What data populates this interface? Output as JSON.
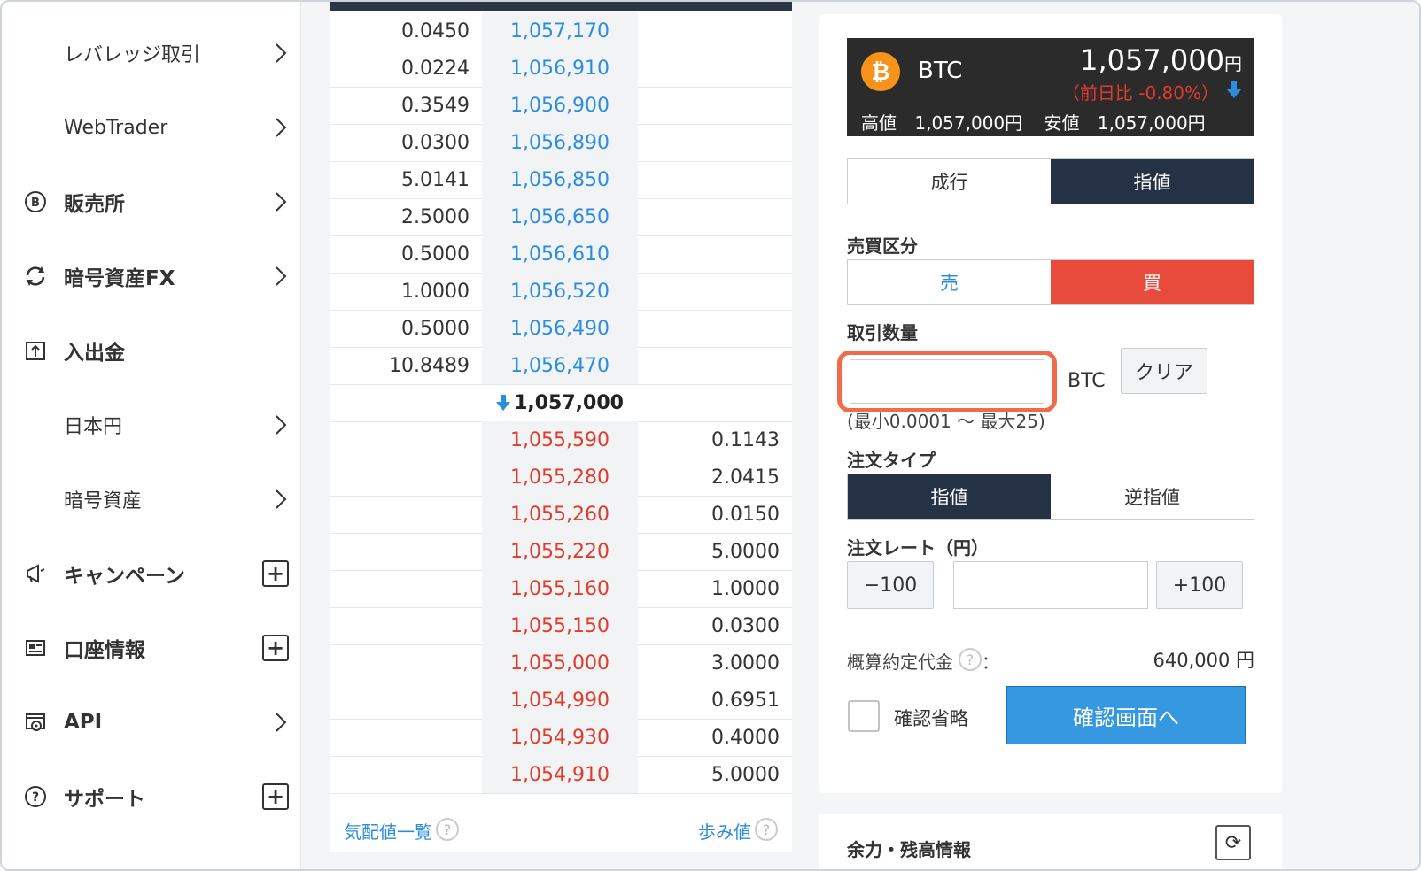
{
  "sidebar": {
    "items": [
      {
        "label": "レバレッジ取引",
        "icon": "",
        "control": "chevron"
      },
      {
        "label": "WebTrader",
        "icon": "",
        "control": "chevron"
      },
      {
        "label": "販売所",
        "icon": "bitcoin-circle-icon",
        "control": "chevron"
      },
      {
        "label": "暗号資産FX",
        "icon": "exchange-arrows-icon",
        "control": "chevron"
      },
      {
        "label": "入出金",
        "icon": "deposit-upload-icon",
        "control": "none"
      },
      {
        "label": "日本円",
        "icon": "",
        "control": "chevron"
      },
      {
        "label": "暗号資産",
        "icon": "",
        "control": "chevron"
      },
      {
        "label": "キャンペーン",
        "icon": "megaphone-icon",
        "control": "plus"
      },
      {
        "label": "口座情報",
        "icon": "id-card-icon",
        "control": "plus"
      },
      {
        "label": "API",
        "icon": "api-gear-icon",
        "control": "chevron"
      },
      {
        "label": "サポート",
        "icon": "question-circle-icon",
        "control": "plus"
      }
    ],
    "plus_symbol": "+"
  },
  "order_book": {
    "asks": [
      {
        "qty": "0.0450",
        "price": "1,057,170"
      },
      {
        "qty": "0.0224",
        "price": "1,056,910"
      },
      {
        "qty": "0.3549",
        "price": "1,056,900"
      },
      {
        "qty": "0.0300",
        "price": "1,056,890"
      },
      {
        "qty": "5.0141",
        "price": "1,056,850"
      },
      {
        "qty": "2.5000",
        "price": "1,056,650"
      },
      {
        "qty": "0.5000",
        "price": "1,056,610"
      },
      {
        "qty": "1.0000",
        "price": "1,056,520"
      },
      {
        "qty": "0.5000",
        "price": "1,056,490"
      },
      {
        "qty": "10.8489",
        "price": "1,056,470"
      }
    ],
    "mid_price": "1,057,000",
    "bids": [
      {
        "price": "1,055,590",
        "qty": "0.1143"
      },
      {
        "price": "1,055,280",
        "qty": "2.0415"
      },
      {
        "price": "1,055,260",
        "qty": "0.0150"
      },
      {
        "price": "1,055,220",
        "qty": "5.0000"
      },
      {
        "price": "1,055,160",
        "qty": "1.0000"
      },
      {
        "price": "1,055,150",
        "qty": "0.0300"
      },
      {
        "price": "1,055,000",
        "qty": "3.0000"
      },
      {
        "price": "1,054,990",
        "qty": "0.6951"
      },
      {
        "price": "1,054,930",
        "qty": "0.4000"
      },
      {
        "price": "1,054,910",
        "qty": "5.0000"
      }
    ],
    "footer": {
      "quotes_link": "気配値一覧",
      "trades_link": "歩み値",
      "help": "?"
    }
  },
  "ticker": {
    "logo_char": "₿",
    "symbol": "BTC",
    "price": "1,057,000",
    "price_unit": "円",
    "change": "（前日比 -0.80%）",
    "high_label": "高値",
    "high_value": "1,057,000円",
    "low_label": "安値",
    "low_value": "1,057,000円"
  },
  "order_form": {
    "type_tabs": {
      "market": "成行",
      "limit": "指値"
    },
    "side_label": "売買区分",
    "side_tabs": {
      "sell": "売",
      "buy": "買"
    },
    "qty_label": "取引数量",
    "qty_value": "",
    "qty_unit": "BTC",
    "clear_button": "クリア",
    "qty_range": "(最小0.0001 〜 最大25)",
    "order_type_label": "注文タイプ",
    "order_type_tabs": {
      "limit": "指値",
      "stop": "逆指値"
    },
    "rate_label": "注文レート（円）",
    "minus_button": "−100",
    "plus_button": "+100",
    "rate_value": "",
    "estimate_label": "概算約定代金",
    "estimate_colon": "：",
    "estimate_value": "640,000 円",
    "skip_confirm_label": "確認省略",
    "confirm_button": "確認画面へ"
  },
  "balance_panel": {
    "title": "余力・残高情報",
    "refresh_icon": "⟳"
  },
  "colors": {
    "ask": "#2b8de0",
    "bid": "#e23a2b",
    "dark_tab": "#253245",
    "buy_tab": "#e84b3c",
    "confirm": "#3598e0",
    "highlight": "#f16a4a"
  }
}
